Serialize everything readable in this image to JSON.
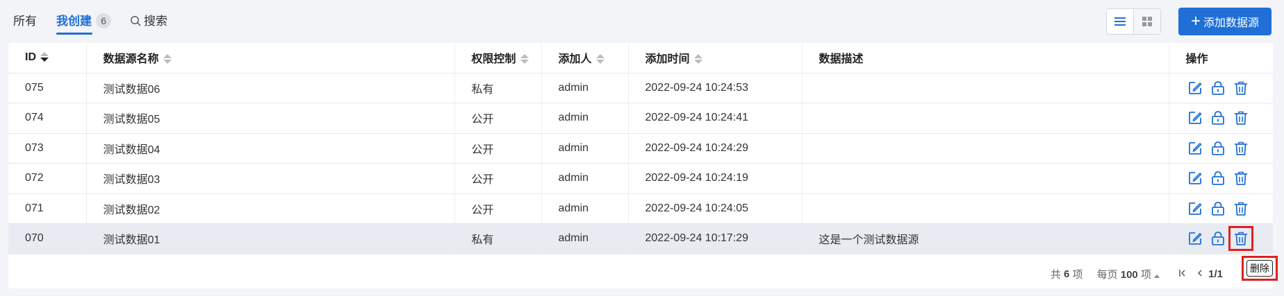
{
  "tabs": {
    "all": "所有",
    "mine": "我创建",
    "mine_count": "6",
    "search": "搜索"
  },
  "toolbar": {
    "add_label": "添加数据源",
    "add_plus": "+"
  },
  "colors": {
    "accent": "#1f6fd6",
    "highlight": "#e02020",
    "selected_row": "#e8ebf1"
  },
  "table": {
    "headers": [
      "ID",
      "数据源名称",
      "权限控制",
      "添加人",
      "添加时间",
      "数据描述",
      "操作"
    ],
    "rows": [
      {
        "id": "075",
        "name": "测试数据06",
        "perm": "私有",
        "user": "admin",
        "time": "2022-09-24 10:24:53",
        "desc": ""
      },
      {
        "id": "074",
        "name": "测试数据05",
        "perm": "公开",
        "user": "admin",
        "time": "2022-09-24 10:24:41",
        "desc": ""
      },
      {
        "id": "073",
        "name": "测试数据04",
        "perm": "公开",
        "user": "admin",
        "time": "2022-09-24 10:24:29",
        "desc": ""
      },
      {
        "id": "072",
        "name": "测试数据03",
        "perm": "公开",
        "user": "admin",
        "time": "2022-09-24 10:24:19",
        "desc": ""
      },
      {
        "id": "071",
        "name": "测试数据02",
        "perm": "公开",
        "user": "admin",
        "time": "2022-09-24 10:24:05",
        "desc": ""
      },
      {
        "id": "070",
        "name": "测试数据01",
        "perm": "私有",
        "user": "admin",
        "time": "2022-09-24 10:17:29",
        "desc": "这是一个测试数据源"
      }
    ],
    "op_icons": [
      "edit-icon",
      "lock-icon",
      "trash-icon"
    ]
  },
  "pager": {
    "total_prefix": "共",
    "total": "6",
    "total_suffix": "项",
    "per_page_prefix": "每页",
    "per_page": "100",
    "per_page_suffix": "项",
    "page": "1/1"
  },
  "tooltip": {
    "text": "删除"
  }
}
